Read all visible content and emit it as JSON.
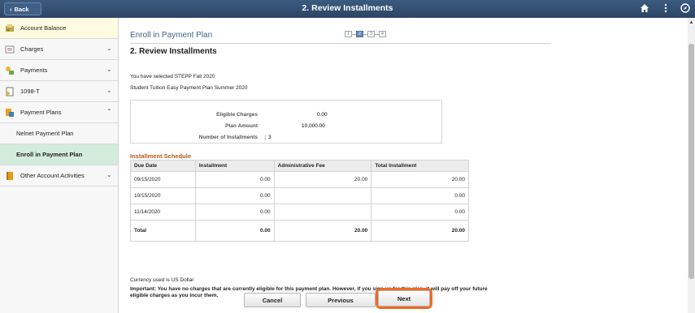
{
  "header": {
    "back_label": "Back",
    "title": "2. Review Installments"
  },
  "sidebar": {
    "items": [
      {
        "label": "Account Balance"
      },
      {
        "label": "Charges"
      },
      {
        "label": "Payments"
      },
      {
        "label": "1098-T"
      },
      {
        "label": "Payment Plans"
      },
      {
        "label": "Nelnet Payment Plan"
      },
      {
        "label": "Enroll in Payment Plan"
      },
      {
        "label": "Other Account Activities"
      }
    ]
  },
  "main": {
    "enroll_title": "Enroll in Payment Plan",
    "steps": [
      "1",
      "2",
      "3",
      "4"
    ],
    "section_title": "2. Review Installments",
    "selected_line1": "You have selected STEPP Fall 2020",
    "selected_line2": "Student Tuition Easy Payment Plan Summer 2020",
    "summary": {
      "eligible_label": "Eligible Charges",
      "eligible_value": "0.00",
      "plan_label": "Plan Amount",
      "plan_value": "10,000.00",
      "count_label": "Number of Installments",
      "count_value": "3"
    },
    "schedule_title": "Installment Schedule",
    "table": {
      "headers": [
        "Due Date",
        "Installment",
        "Administrative Fee",
        "Total Installment"
      ],
      "rows": [
        [
          "09/15/2020",
          "0.00",
          "20.00",
          "20.00"
        ],
        [
          "10/15/2020",
          "0.00",
          "",
          "0.00"
        ],
        [
          "11/14/2020",
          "0.00",
          "",
          "0.00"
        ]
      ],
      "total": [
        "Total",
        "0.00",
        "20.00",
        "20.00"
      ]
    },
    "currency": "Currency used is US Dollar",
    "important": "Important:  You have no charges that are currently eligible for this payment plan.  However, if you sign up for this plan, it will pay off your future eligible charges as you incur them.",
    "buttons": {
      "cancel": "Cancel",
      "previous": "Previous",
      "next": "Next"
    }
  },
  "colors": {
    "header_bg": "#34506f",
    "active_nav": "#d3ecdc",
    "accent_orange": "#f06a24",
    "link_blue": "#3f648c",
    "schedule_title": "#b45a16"
  }
}
